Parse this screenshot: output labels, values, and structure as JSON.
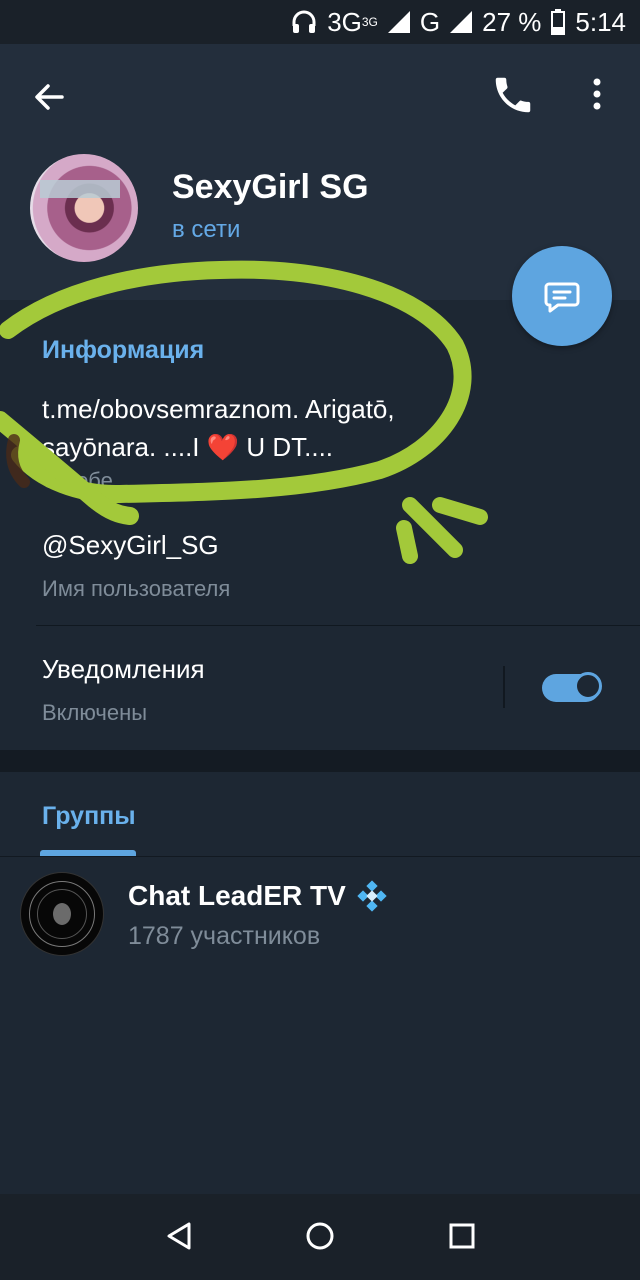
{
  "status_bar": {
    "network_1": "3G",
    "network_1_sup": "3G",
    "network_2": "G",
    "battery": "27 %",
    "time": "5:14",
    "icons": [
      "headphones-icon",
      "signal-icon",
      "battery-icon"
    ]
  },
  "header": {
    "name": "SexyGirl SG",
    "status": "в сети",
    "icons": [
      "back-arrow-icon",
      "phone-icon",
      "more-vert-icon",
      "message-icon"
    ]
  },
  "info": {
    "section_title": "Информация",
    "bio_line1": "t.me/obovsemraznom. Arigatō,",
    "bio_line2_a": "sayōnara. ....I ",
    "bio_heart": "❤️",
    "bio_line2_b": " U DT....",
    "bio_label": "О себе",
    "username": "@SexyGirl_SG",
    "username_label": "Имя пользователя",
    "notifications_title": "Уведомления",
    "notifications_state": "Включены",
    "notifications_enabled": true
  },
  "groups": {
    "tab_label": "Группы",
    "items": [
      {
        "name": "Chat LeadER TV",
        "members": "1787 участников",
        "badge_icon": "diamond-icon"
      }
    ]
  },
  "colors": {
    "accent": "#5ea5e0",
    "header_bg": "#232e3c",
    "body_bg": "#1d2733",
    "annotation": "#a3c93a"
  }
}
